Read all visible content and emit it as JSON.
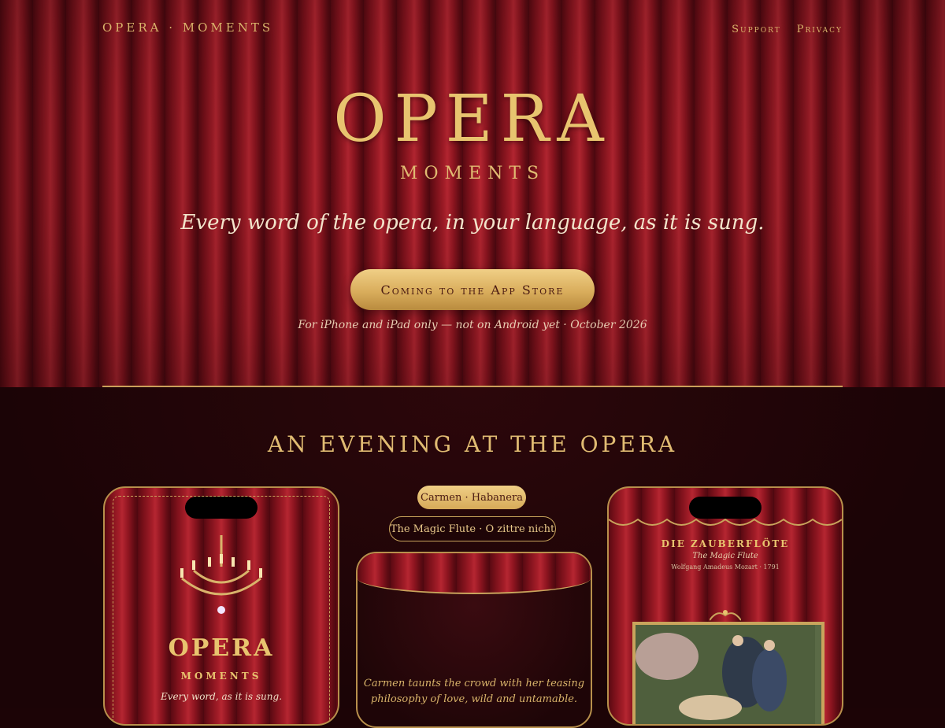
{
  "nav": {
    "brand": "OPERA · MOMENTS",
    "links": [
      "Support",
      "Privacy"
    ]
  },
  "hero": {
    "title": "OPERA",
    "subtitle": "MOMENTS",
    "tagline": "Every word of the opera, in your language, as it is sung.",
    "cta_label": "Coming to the App Store",
    "cta_note": "For iPhone and iPad only — not on Android yet · October 2026"
  },
  "section": {
    "title": "AN EVENING AT THE OPERA"
  },
  "phone_left": {
    "title": "OPERA",
    "subtitle": "MOMENTS",
    "tagline": "Every word, as it is sung."
  },
  "chips": {
    "active": "Carmen · Habanera",
    "inactive": "The Magic Flute · O zittre nicht"
  },
  "phone_mid": {
    "caption_line1": "Carmen taunts the crowd with her teasing",
    "caption_line2": "philosophy of love, wild and untamable."
  },
  "phone_right": {
    "title": "DIE ZAUBERFLÖTE",
    "subtitle": "The Magic Flute",
    "credit": "Wolfgang Amadeus Mozart · 1791"
  },
  "colors": {
    "gold": "#e8c46f",
    "curtain_red": "#a31d28",
    "background_dark": "#1c0406"
  }
}
